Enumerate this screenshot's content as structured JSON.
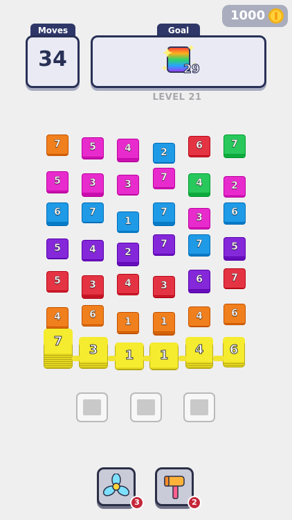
{
  "coins": {
    "amount": "1000"
  },
  "moves": {
    "label": "Moves",
    "value": "34"
  },
  "goal": {
    "label": "Goal",
    "count": "29"
  },
  "level": {
    "text": "LEVEL 21"
  },
  "colors": {
    "orange": "#f07f1d",
    "magenta": "#e82bcc",
    "blue": "#1f9ae6",
    "purple": "#8428d9",
    "red": "#e43444",
    "green": "#29c85c",
    "yellow": "#f5eb2f"
  },
  "board": {
    "columns": [
      {
        "tiles": [
          {
            "n": "7",
            "color": "orange"
          },
          {
            "n": "5",
            "color": "magenta"
          },
          {
            "n": "6",
            "color": "blue"
          },
          {
            "n": "5",
            "color": "purple"
          },
          {
            "n": "5",
            "color": "red"
          },
          {
            "n": "4",
            "color": "orange"
          }
        ]
      },
      {
        "tiles": [
          {
            "n": "5",
            "color": "magenta"
          },
          {
            "n": "3",
            "color": "magenta"
          },
          {
            "n": "7",
            "color": "blue"
          },
          {
            "n": "4",
            "color": "purple"
          },
          {
            "n": "3",
            "color": "red"
          },
          {
            "n": "6",
            "color": "orange"
          }
        ]
      },
      {
        "tiles": [
          {
            "n": "4",
            "color": "magenta"
          },
          {
            "n": "3",
            "color": "magenta"
          },
          {
            "n": "1",
            "color": "blue"
          },
          {
            "n": "2",
            "color": "purple"
          },
          {
            "n": "4",
            "color": "red"
          },
          {
            "n": "1",
            "color": "orange"
          }
        ]
      },
      {
        "tiles": [
          {
            "n": "2",
            "color": "blue"
          },
          {
            "n": "7",
            "color": "magenta"
          },
          {
            "n": "7",
            "color": "blue"
          },
          {
            "n": "7",
            "color": "purple"
          },
          {
            "n": "3",
            "color": "red"
          },
          {
            "n": "1",
            "color": "orange"
          }
        ]
      },
      {
        "tiles": [
          {
            "n": "6",
            "color": "red"
          },
          {
            "n": "4",
            "color": "green"
          },
          {
            "n": "3",
            "color": "magenta"
          },
          {
            "n": "7",
            "color": "blue"
          },
          {
            "n": "6",
            "color": "purple"
          },
          {
            "n": "4",
            "color": "orange"
          }
        ]
      },
      {
        "tiles": [
          {
            "n": "7",
            "color": "green"
          },
          {
            "n": "2",
            "color": "magenta"
          },
          {
            "n": "6",
            "color": "blue"
          },
          {
            "n": "5",
            "color": "purple"
          },
          {
            "n": "7",
            "color": "red"
          },
          {
            "n": "6",
            "color": "orange"
          }
        ]
      }
    ],
    "front_row": [
      {
        "n": "7"
      },
      {
        "n": "3"
      },
      {
        "n": "1"
      },
      {
        "n": "1"
      },
      {
        "n": "4"
      },
      {
        "n": "6"
      }
    ]
  },
  "slots": [
    {
      "state": "empty"
    },
    {
      "state": "empty"
    },
    {
      "state": "empty"
    }
  ],
  "boosters": [
    {
      "icon": "fan-icon",
      "count": "3"
    },
    {
      "icon": "hammer-icon",
      "count": "2"
    }
  ]
}
